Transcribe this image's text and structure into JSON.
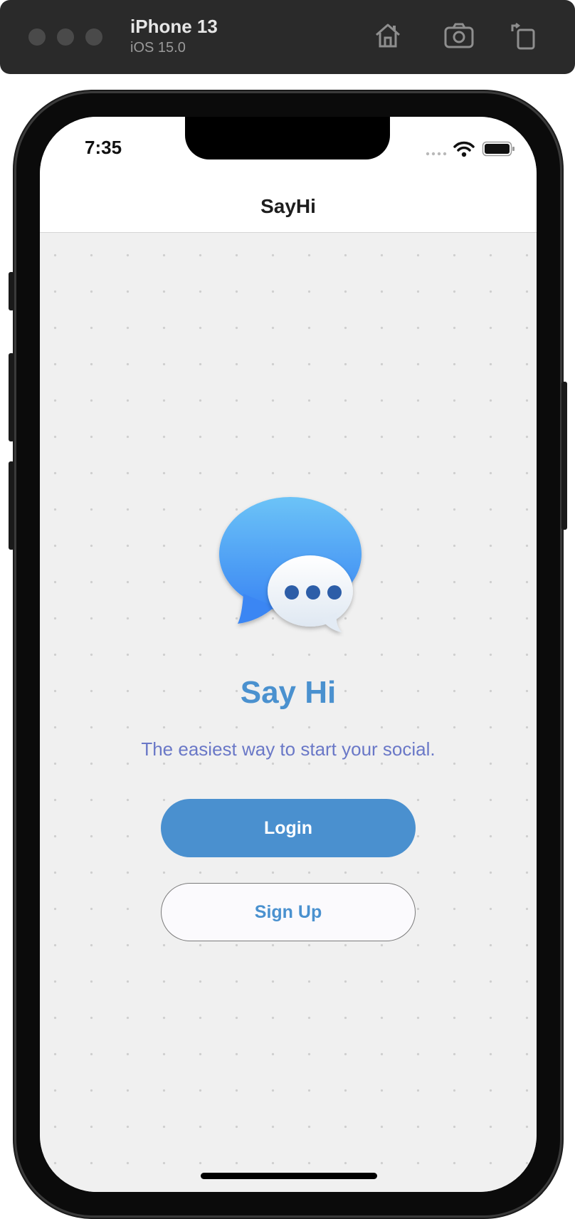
{
  "simulator": {
    "device_name": "iPhone 13",
    "os_version": "iOS 15.0",
    "icons": [
      "home-icon",
      "screenshot-icon",
      "rotate-icon"
    ]
  },
  "status_bar": {
    "time": "7:35",
    "icons": [
      "signal-icon",
      "wifi-icon",
      "battery-icon"
    ]
  },
  "nav": {
    "title": "SayHi"
  },
  "main": {
    "logo_icon": "chat-bubbles-icon",
    "app_title": "Say Hi",
    "tagline": "The easiest way to start your social.",
    "login_label": "Login",
    "signup_label": "Sign Up"
  },
  "colors": {
    "accent": "#4a90cf",
    "tagline": "#6a78c7",
    "background": "#f0f0f0"
  }
}
